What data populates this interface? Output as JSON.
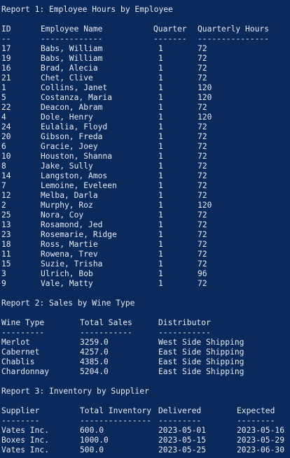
{
  "report1": {
    "title": "Report 1: Employee Hours by Employee",
    "headers": {
      "id": "ID",
      "name": "Employee Name",
      "quarter": "Quarter",
      "hours": "Quarterly Hours"
    },
    "dashes": {
      "id": "--",
      "name": "-------------",
      "quarter": "-------",
      "hours": "---------------"
    },
    "rows": [
      {
        "id": "17",
        "name": "Babs, William",
        "quarter": "1",
        "hours": "72"
      },
      {
        "id": "19",
        "name": "Babs, William",
        "quarter": "1",
        "hours": "72"
      },
      {
        "id": "16",
        "name": "Brad, Alecia",
        "quarter": "1",
        "hours": "72"
      },
      {
        "id": "21",
        "name": "Chet, Clive",
        "quarter": "1",
        "hours": "72"
      },
      {
        "id": "1",
        "name": "Collins, Janet",
        "quarter": "1",
        "hours": "120"
      },
      {
        "id": "5",
        "name": "Costanza, Maria",
        "quarter": "1",
        "hours": "120"
      },
      {
        "id": "22",
        "name": "Deacon, Abram",
        "quarter": "1",
        "hours": "72"
      },
      {
        "id": "4",
        "name": "Dole, Henry",
        "quarter": "1",
        "hours": "120"
      },
      {
        "id": "24",
        "name": "Eulalia, Floyd",
        "quarter": "1",
        "hours": "72"
      },
      {
        "id": "20",
        "name": "Gibson, Freda",
        "quarter": "1",
        "hours": "72"
      },
      {
        "id": "6",
        "name": "Gracie, Joey",
        "quarter": "1",
        "hours": "72"
      },
      {
        "id": "10",
        "name": "Houston, Shanna",
        "quarter": "1",
        "hours": "72"
      },
      {
        "id": "8",
        "name": "Jake, Sully",
        "quarter": "1",
        "hours": "72"
      },
      {
        "id": "14",
        "name": "Langston, Amos",
        "quarter": "1",
        "hours": "72"
      },
      {
        "id": "7",
        "name": "Lemoine, Eveleen",
        "quarter": "1",
        "hours": "72"
      },
      {
        "id": "12",
        "name": "Melba, Darla",
        "quarter": "1",
        "hours": "72"
      },
      {
        "id": "2",
        "name": "Murphy, Roz",
        "quarter": "1",
        "hours": "120"
      },
      {
        "id": "25",
        "name": "Nora, Coy",
        "quarter": "1",
        "hours": "72"
      },
      {
        "id": "13",
        "name": "Rosamond, Jed",
        "quarter": "1",
        "hours": "72"
      },
      {
        "id": "23",
        "name": "Rosemarie, Ridge",
        "quarter": "1",
        "hours": "72"
      },
      {
        "id": "18",
        "name": "Ross, Martie",
        "quarter": "1",
        "hours": "72"
      },
      {
        "id": "11",
        "name": "Rowena, Trev",
        "quarter": "1",
        "hours": "72"
      },
      {
        "id": "15",
        "name": "Suzie, Trisha",
        "quarter": "1",
        "hours": "72"
      },
      {
        "id": "3",
        "name": "Ulrich, Bob",
        "quarter": "1",
        "hours": "96"
      },
      {
        "id": "9",
        "name": "Vale, Matty",
        "quarter": "1",
        "hours": "72"
      }
    ]
  },
  "report2": {
    "title": "Report 2: Sales by Wine Type",
    "headers": {
      "type": "Wine Type",
      "sales": "Total Sales",
      "distributor": "Distributor"
    },
    "dashes": {
      "type": "---------",
      "sales": "-----------",
      "distributor": "-----------"
    },
    "rows": [
      {
        "type": "Merlot",
        "sales": "3259.0",
        "distributor": "West Side Shipping"
      },
      {
        "type": "Cabernet",
        "sales": "4257.0",
        "distributor": "East Side Shipping"
      },
      {
        "type": "Chablis",
        "sales": "4385.0",
        "distributor": "East Side Shipping"
      },
      {
        "type": "Chardonnay",
        "sales": "5204.0",
        "distributor": "East Side Shipping"
      }
    ]
  },
  "report3": {
    "title": "Report 3: Inventory by Supplier",
    "headers": {
      "supplier": "Supplier",
      "inventory": "Total Inventory",
      "delivered": "Delivered",
      "expected": "Expected"
    },
    "dashes": {
      "supplier": "--------",
      "inventory": "---------------",
      "delivered": "---------",
      "expected": "--------"
    },
    "rows": [
      {
        "supplier": "Vates Inc.",
        "inventory": "600.0",
        "delivered": "2023-05-01",
        "expected": "2023-05-16"
      },
      {
        "supplier": "Boxes Inc.",
        "inventory": "1000.0",
        "delivered": "2023-05-15",
        "expected": "2023-05-29"
      },
      {
        "supplier": "Vates Inc.",
        "inventory": "500.0",
        "delivered": "2023-05-25",
        "expected": "2023-06-30"
      }
    ]
  },
  "theme": {
    "background": "#0a2a5c",
    "text": "#e8ecf4"
  }
}
